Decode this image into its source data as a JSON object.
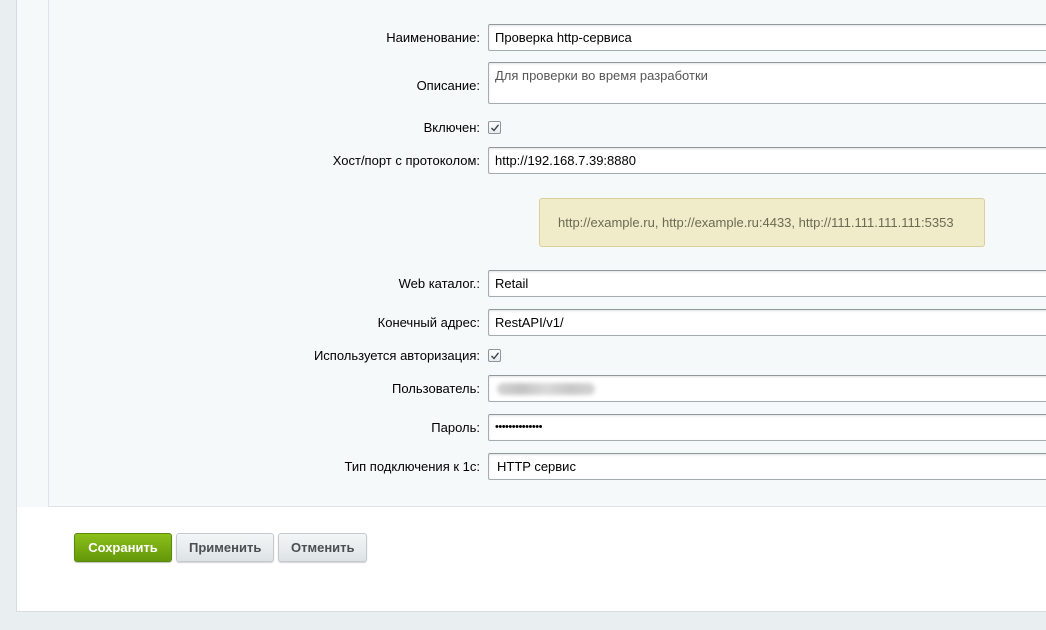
{
  "form": {
    "name_label": "Наименование:",
    "name_value": "Проверка http-сервиса",
    "description_label": "Описание:",
    "description_value": "Для проверки во время разработки",
    "enabled_label": "Включен:",
    "enabled_checked": true,
    "host_label": "Хост/порт с протоколом:",
    "host_value": "http://192.168.7.39:8880",
    "host_hint": "http://example.ru, http://example.ru:4433, http://111.111.111.111:5353",
    "web_catalog_label": "Web каталог.:",
    "web_catalog_value": "Retail",
    "endpoint_label": "Конечный адрес:",
    "endpoint_value": "RestAPI/v1/",
    "auth_label": "Используется авторизация:",
    "auth_checked": true,
    "user_label": "Пользователь:",
    "password_label": "Пароль:",
    "password_value": "••••••••••••••",
    "connection_type_label": "Тип подключения к 1с:",
    "connection_type_value": "HTTP сервис"
  },
  "buttons": {
    "save": "Сохранить",
    "apply": "Применить",
    "cancel": "Отменить"
  },
  "icons": {
    "checkbox_check": "check-icon"
  },
  "colors": {
    "save_button": "#76ab12",
    "hint_background": "#f0ecc9"
  }
}
